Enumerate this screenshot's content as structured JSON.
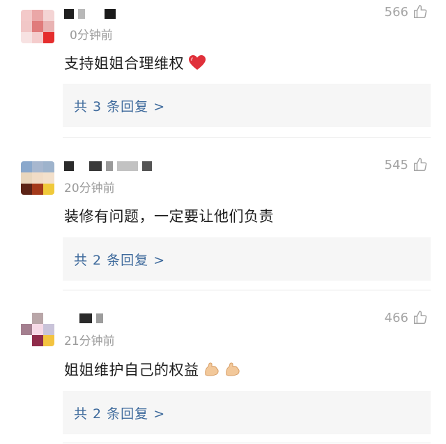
{
  "comments": [
    {
      "time": "0分钟前",
      "likes": "566",
      "text": "支持姐姐合理维权",
      "emoji_icon": "heart-icon",
      "reply_label": "共 3 条回复 >",
      "avatar_colors": [
        "#f3c9c9",
        "#eaa7a7",
        "#f4d4d4",
        "#f1c7c7",
        "#e07b7b",
        "#e9b3b3",
        "#f7e2e2",
        "#f4cccc",
        "#e52d2d"
      ]
    },
    {
      "time": "20分钟前",
      "likes": "545",
      "text": "装修有问题，一定要让他们负责",
      "emoji_icon": "",
      "reply_label": "共 2 条回复 >",
      "avatar_colors": [
        "#8aa8cc",
        "#a7b7cf",
        "#9eb3cc",
        "#e9d6bd",
        "#f1dcc6",
        "#f3e0cb",
        "#5c2316",
        "#a43a1b",
        "#f0c93a"
      ]
    },
    {
      "time": "21分钟前",
      "likes": "466",
      "text": "姐姐维护自己的权益",
      "emoji_icon": "flexed-biceps-icon",
      "reply_label": "共 2 条回复 >",
      "avatar_colors": [
        "#ffffff",
        "#b9a6a8",
        "#ffffff",
        "#a47f8f",
        "#f6d9e6",
        "#c9c3d9",
        "#ffffff",
        "#8f2b4a",
        "#f3c340"
      ]
    }
  ],
  "colors": {
    "reply_text": "#3e6a9c",
    "reply_bg": "#f6f6f6",
    "meta": "#9a9a9a"
  }
}
